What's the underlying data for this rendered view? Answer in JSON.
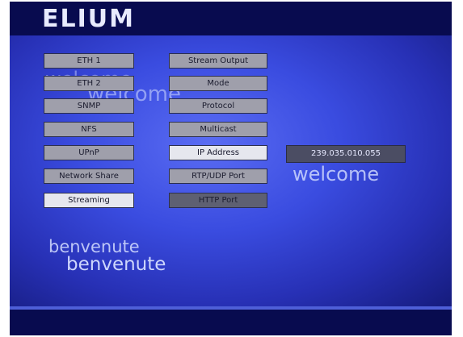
{
  "header": {
    "logo": "ELIUM"
  },
  "background_text": {
    "welcome_1": "welcome",
    "welcome_2": "welcome",
    "welcome_3": "welcome",
    "benvenute_1": "benvenute",
    "benvenute_2": "benvenute"
  },
  "left_menu": [
    {
      "label": "ETH 1",
      "state": "normal"
    },
    {
      "label": "ETH 2",
      "state": "normal"
    },
    {
      "label": "SNMP",
      "state": "normal"
    },
    {
      "label": "NFS",
      "state": "normal"
    },
    {
      "label": "UPnP",
      "state": "normal"
    },
    {
      "label": "Network Share",
      "state": "normal"
    },
    {
      "label": "Streaming",
      "state": "active"
    }
  ],
  "right_menu": [
    {
      "label": "Stream Output",
      "state": "normal"
    },
    {
      "label": "Mode",
      "state": "normal"
    },
    {
      "label": "Protocol",
      "state": "normal"
    },
    {
      "label": "Multicast",
      "state": "normal"
    },
    {
      "label": "IP Address",
      "state": "active"
    },
    {
      "label": "RTP/UDP Port",
      "state": "normal"
    },
    {
      "label": "HTTP Port",
      "state": "focused"
    }
  ],
  "ip_value": "239.035.010.055",
  "colors": {
    "background": "#2730b5",
    "bar": "#080b4f",
    "button": "#9f9fab",
    "button_active": "#e6e7ee",
    "button_focused": "#5e6072"
  }
}
